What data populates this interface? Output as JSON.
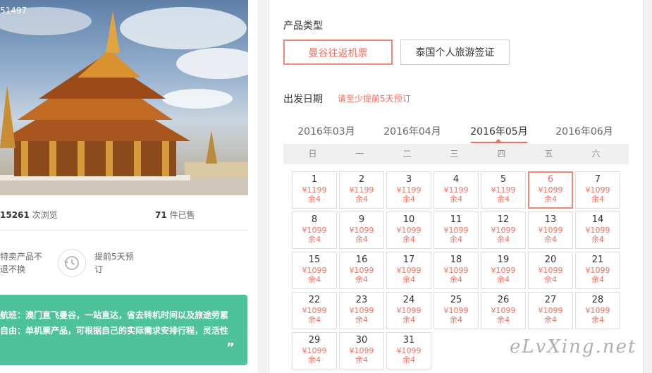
{
  "left": {
    "hero_id": "51497",
    "views_count": "15261",
    "views_label": " 次浏览",
    "sold_count": "71",
    "sold_label": " 件已售",
    "feature1": "特卖产品不退不换",
    "feature2": "提前5天预订",
    "feature_icon": "clock-history-icon",
    "highlight_line1": "航班：澳门直飞曼谷，一站直达，省去转机时间以及旅途劳累",
    "highlight_line2": "自由：单机票产品，可根据自己的实际需求安排行程，灵活性",
    "quote_mark": "”"
  },
  "panel": {
    "product_type_label": "产品类型",
    "product_types": [
      "曼谷往返机票",
      "泰国个人旅游签证"
    ],
    "selected_product_type": 0,
    "date_label": "出发日期",
    "date_hint": "请至少提前5天预订",
    "months": [
      "2016年03月",
      "2016年04月",
      "2016年05月",
      "2016年06月"
    ],
    "active_month": 2,
    "weekdays": [
      "日",
      "一",
      "二",
      "三",
      "四",
      "五",
      "六"
    ],
    "days": [
      {
        "day": "1",
        "price": "¥1199",
        "stock": "余4"
      },
      {
        "day": "2",
        "price": "¥1199",
        "stock": "余4"
      },
      {
        "day": "3",
        "price": "¥1199",
        "stock": "余4"
      },
      {
        "day": "4",
        "price": "¥1199",
        "stock": "余4"
      },
      {
        "day": "5",
        "price": "¥1199",
        "stock": "余4"
      },
      {
        "day": "6",
        "price": "¥1099",
        "stock": "余4",
        "selected": true
      },
      {
        "day": "7",
        "price": "¥1099",
        "stock": "余4"
      },
      {
        "day": "8",
        "price": "¥1099",
        "stock": "余4"
      },
      {
        "day": "9",
        "price": "¥1099",
        "stock": "余4"
      },
      {
        "day": "10",
        "price": "¥1099",
        "stock": "余4"
      },
      {
        "day": "11",
        "price": "¥1099",
        "stock": "余4"
      },
      {
        "day": "12",
        "price": "¥1099",
        "stock": "余4"
      },
      {
        "day": "13",
        "price": "¥1099",
        "stock": "余4"
      },
      {
        "day": "14",
        "price": "¥1099",
        "stock": "余4"
      },
      {
        "day": "15",
        "price": "¥1099",
        "stock": "余4"
      },
      {
        "day": "16",
        "price": "¥1099",
        "stock": "余4"
      },
      {
        "day": "17",
        "price": "¥1099",
        "stock": "余4"
      },
      {
        "day": "18",
        "price": "¥1099",
        "stock": "余4"
      },
      {
        "day": "19",
        "price": "¥1099",
        "stock": "余4"
      },
      {
        "day": "20",
        "price": "¥1099",
        "stock": "余4"
      },
      {
        "day": "21",
        "price": "¥1099",
        "stock": "余4"
      },
      {
        "day": "22",
        "price": "¥1099",
        "stock": "余4"
      },
      {
        "day": "23",
        "price": "¥1099",
        "stock": "余4"
      },
      {
        "day": "24",
        "price": "¥1099",
        "stock": "余4"
      },
      {
        "day": "25",
        "price": "¥1099",
        "stock": "余4"
      },
      {
        "day": "26",
        "price": "¥1099",
        "stock": "余4"
      },
      {
        "day": "27",
        "price": "¥1099",
        "stock": "余4"
      },
      {
        "day": "28",
        "price": "¥1099",
        "stock": "余4"
      },
      {
        "day": "29",
        "price": "¥1099",
        "stock": "余4"
      },
      {
        "day": "30",
        "price": "¥1099",
        "stock": "余4"
      },
      {
        "day": "31",
        "price": "¥1099",
        "stock": "余4"
      }
    ]
  },
  "watermark": "eLvXing.net",
  "colors": {
    "accent": "#f07060",
    "green": "#4dc29b"
  }
}
